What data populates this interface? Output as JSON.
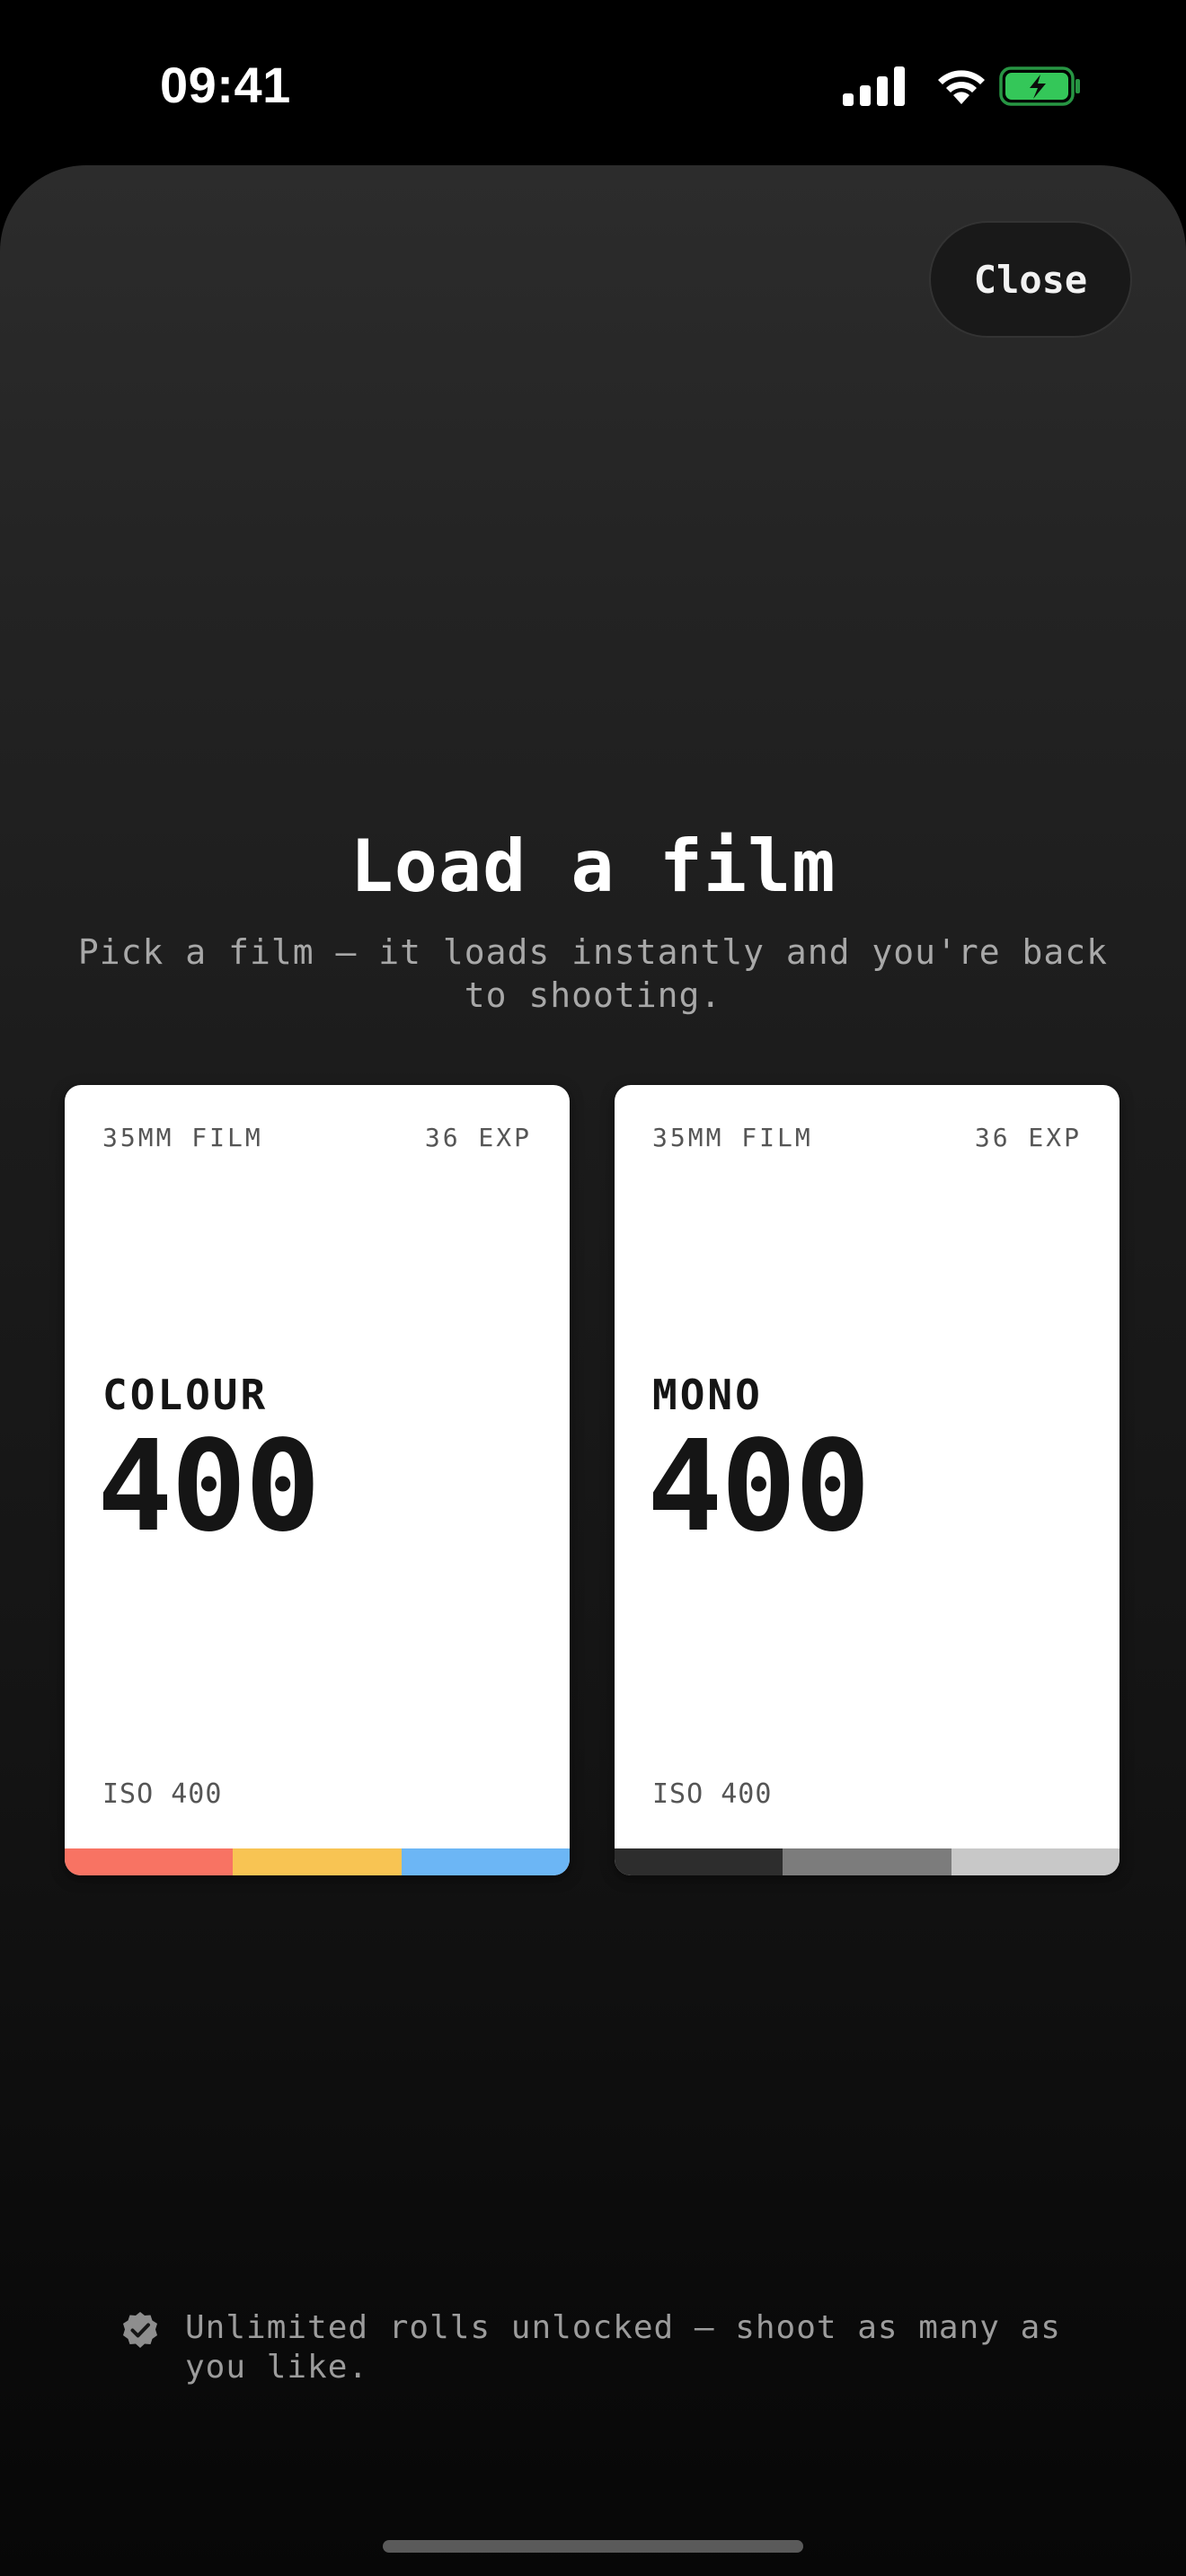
{
  "status_bar": {
    "time": "09:41",
    "icons": [
      "cellular-signal-icon",
      "wifi-icon",
      "battery-charging-icon"
    ],
    "battery_color": "#34c759"
  },
  "header": {
    "close_label": "Close"
  },
  "main": {
    "title": "Load a film",
    "subtitle": "Pick a film — it loads instantly and you're back to shooting."
  },
  "films": [
    {
      "format": "35MM FILM",
      "exposures": "36 EXP",
      "name": "COLOUR",
      "speed": "400",
      "iso": "ISO 400",
      "stripe_colors": [
        "#f87363",
        "#f8c453",
        "#6cb6f5"
      ]
    },
    {
      "format": "35MM FILM",
      "exposures": "36 EXP",
      "name": "MONO",
      "speed": "400",
      "iso": "ISO 400",
      "stripe_colors": [
        "#2d2d2d",
        "#7c7c7c",
        "#c8c8c8"
      ]
    }
  ],
  "footer": {
    "note": "Unlimited rolls unlocked — shoot as many as you like.",
    "icon": "verified-badge-icon"
  }
}
